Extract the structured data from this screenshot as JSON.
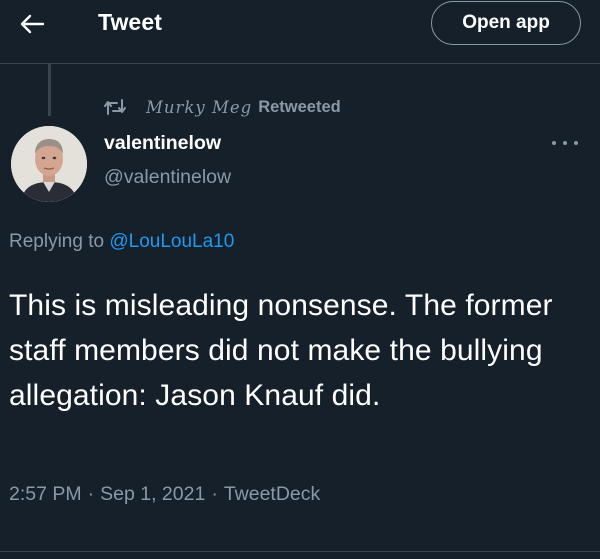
{
  "header": {
    "back_icon": "arrow-left-icon",
    "title": "Tweet",
    "open_app_label": "Open app"
  },
  "retweet": {
    "icon": "retweet-icon",
    "retweeter": "Murky Meg",
    "suffix": "Retweeted"
  },
  "tweet": {
    "author": {
      "display_name": "valentinelow",
      "handle": "@valentinelow",
      "avatar": "avatar-photo"
    },
    "more_icon": "more-horizontal-icon",
    "reply": {
      "prefix": "Replying to ",
      "to": "@LouLouLa10"
    },
    "text": "This is misleading nonsense. The former staff members did not make the bullying allegation: Jason Knauf did.",
    "meta": {
      "time": "2:57 PM",
      "separator": "·",
      "date": "Sep 1, 2021",
      "source": "TweetDeck"
    }
  },
  "colors": {
    "background": "#15202b",
    "text_primary": "#ffffff",
    "text_secondary": "#8b98a5",
    "link": "#1d9bf0",
    "divider": "#38444d"
  }
}
